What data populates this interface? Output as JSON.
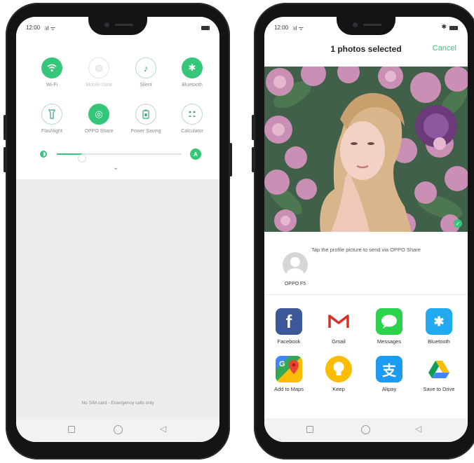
{
  "left_phone": {
    "status": {
      "time": "12:00"
    },
    "quick_settings": [
      {
        "label": "Wi-Fi",
        "state": "on",
        "icon": "wifi-icon"
      },
      {
        "label": "Mobile Data",
        "state": "disabled",
        "icon": "globe-icon"
      },
      {
        "label": "Silent",
        "state": "off",
        "icon": "bell-off-icon"
      },
      {
        "label": "Bluetooth",
        "state": "on",
        "icon": "bluetooth-icon"
      },
      {
        "label": "Flashlight",
        "state": "off",
        "icon": "flashlight-icon"
      },
      {
        "label": "OPPO Share",
        "state": "on",
        "icon": "oppo-share-icon"
      },
      {
        "label": "Power Saving",
        "state": "off",
        "icon": "battery-icon"
      },
      {
        "label": "Calculator",
        "state": "off",
        "icon": "calculator-icon"
      }
    ],
    "brightness": {
      "level": 0.2,
      "auto_label": "A"
    },
    "emergency_text": "No SIM card - Emergency calls only"
  },
  "right_phone": {
    "status": {
      "time": "12:00"
    },
    "sheet": {
      "title": "1 photos selected",
      "cancel_label": "Cancel"
    },
    "share_hint": "Tap the profile picture to send via OPPO Share",
    "nearby_device": {
      "name": "OPPO F5"
    },
    "apps": [
      {
        "label": "Facebook",
        "icon": "facebook-icon",
        "color": "#3b5998",
        "glyph": "f"
      },
      {
        "label": "Gmail",
        "icon": "gmail-icon",
        "color": "#ffffff",
        "glyph": "M"
      },
      {
        "label": "Messages",
        "icon": "messages-icon",
        "color": "#2bd24b",
        "glyph": "💬"
      },
      {
        "label": "Bluetooth",
        "icon": "bluetooth-icon",
        "color": "#22aaf0",
        "glyph": "✱"
      },
      {
        "label": "Add to Maps",
        "icon": "maps-icon",
        "color": "#4caf50",
        "glyph": "G"
      },
      {
        "label": "Keep",
        "icon": "keep-icon",
        "color": "#fbbc04",
        "glyph": "💡"
      },
      {
        "label": "Alipay",
        "icon": "alipay-icon",
        "color": "#1d9bf0",
        "glyph": "支"
      },
      {
        "label": "Save to Drive",
        "icon": "drive-icon",
        "color": "#ffffff",
        "glyph": "▲"
      }
    ]
  },
  "colors": {
    "accent": "#34c679"
  }
}
